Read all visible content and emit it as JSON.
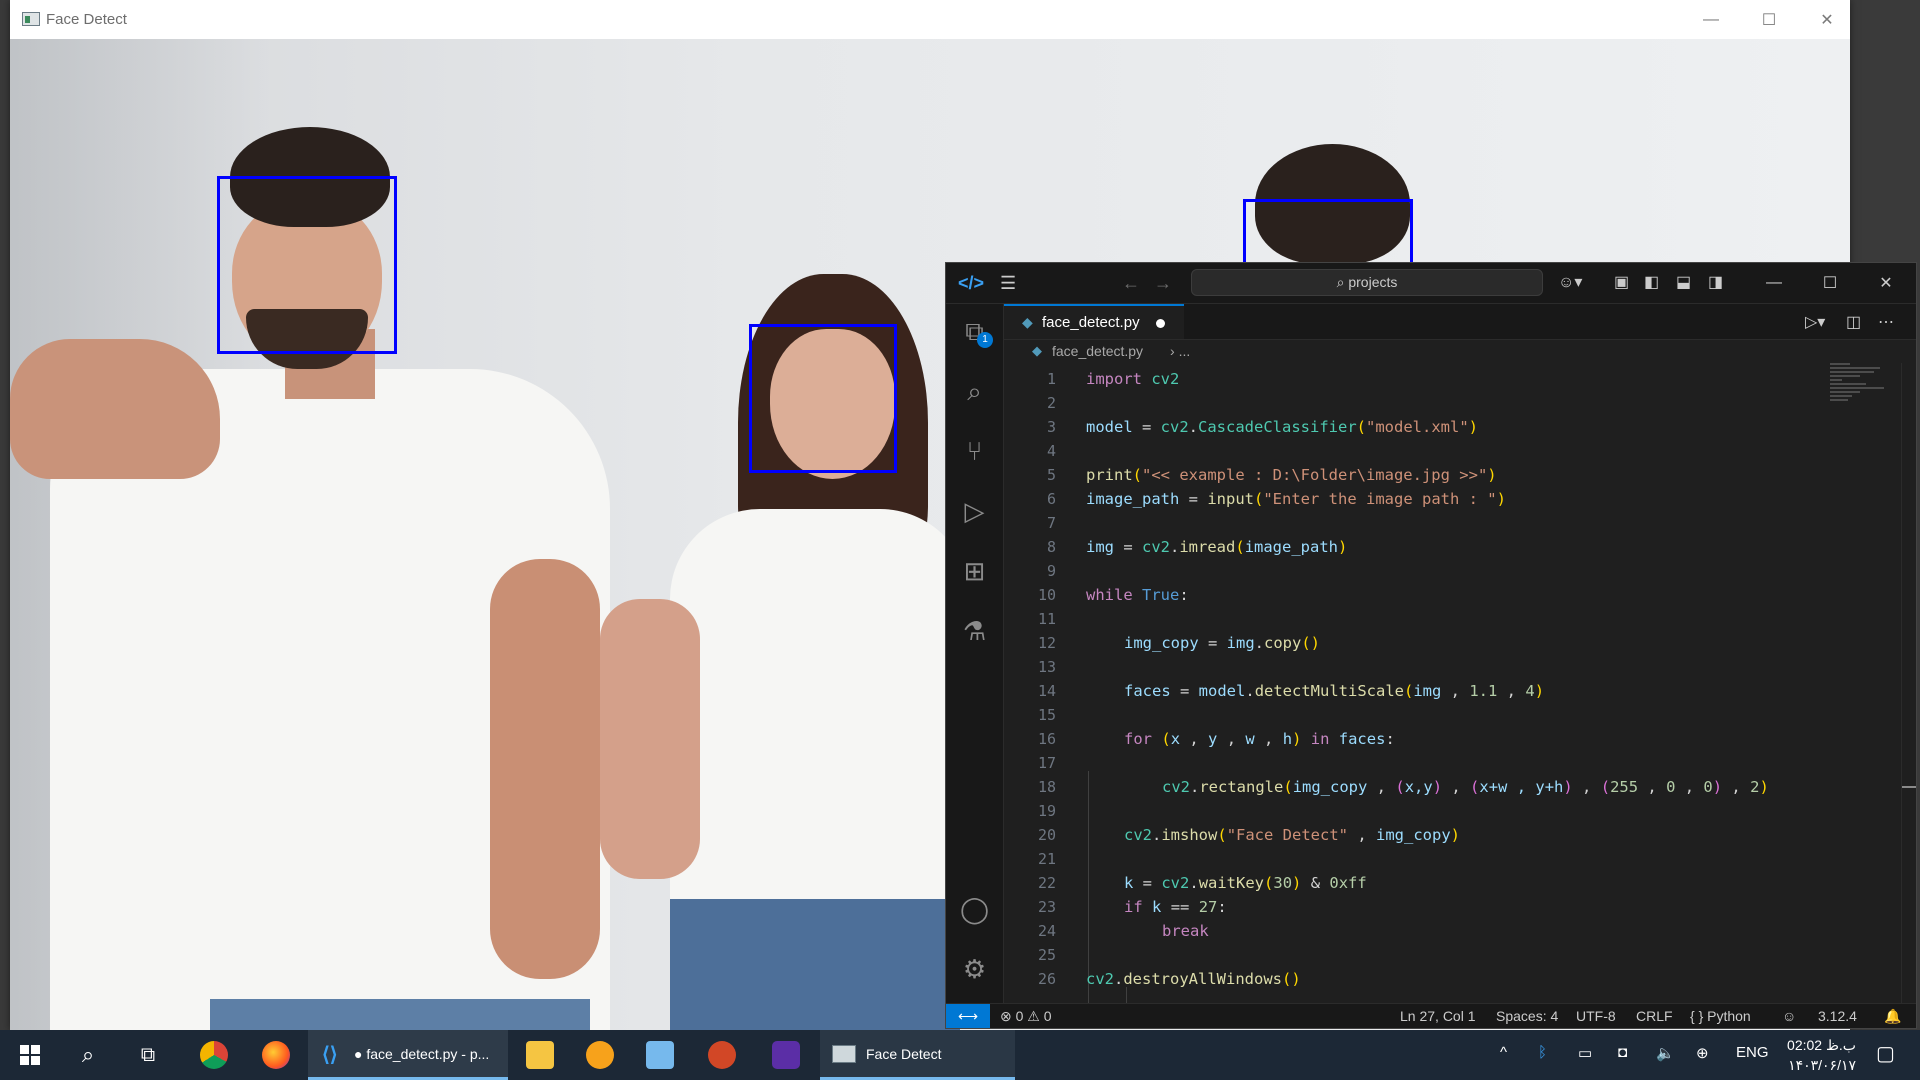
{
  "face_window": {
    "title": "Face Detect",
    "controls": [
      "—",
      "☐",
      "✕"
    ]
  },
  "vscode": {
    "search_label": "projects",
    "tab": {
      "filename": "face_detect.py"
    },
    "breadcrumb": {
      "file": "face_detect.py",
      "rest": "..."
    },
    "explorer_badge": "1",
    "line_numbers": [
      "1",
      "2",
      "3",
      "4",
      "5",
      "6",
      "7",
      "8",
      "9",
      "10",
      "11",
      "12",
      "13",
      "14",
      "15",
      "16",
      "17",
      "18",
      "19",
      "20",
      "21",
      "22",
      "23",
      "24",
      "25",
      "26"
    ],
    "code": {
      "l1_kw": "import",
      "l1_mod": "cv2",
      "l3_var": "model",
      "l3_mod": "cv2",
      "l3_cls": "CascadeClassifier",
      "l3_str": "\"model.xml\"",
      "l5_fn": "print",
      "l5_str": "\"<< example : D:\\Folder\\image.jpg >>\"",
      "l6_var": "image_path",
      "l6_fn": "input",
      "l6_str": "\"Enter the image path : \"",
      "l8_var": "img",
      "l8_mod": "cv2",
      "l8_fn": "imread",
      "l8_arg": "image_path",
      "l10_kw": "while",
      "l10_const": "True",
      "l12_var": "img_copy",
      "l12_obj": "img",
      "l12_fn": "copy",
      "l14_var": "faces",
      "l14_obj": "model",
      "l14_fn": "detectMultiScale",
      "l14_arg": "img",
      "l14_n1": "1.1",
      "l14_n2": "4",
      "l16_kw": "for",
      "l16_x": "x",
      "l16_y": "y",
      "l16_w": "w",
      "l16_h": "h",
      "l16_in": "in",
      "l16_faces": "faces",
      "l18_mod": "cv2",
      "l18_fn": "rectangle",
      "l18_a1": "img_copy",
      "l18_a2": "x,y",
      "l18_a3": "x+w , y+h",
      "l18_c1": "255",
      "l18_c2": "0",
      "l18_c3": "0",
      "l18_t": "2",
      "l20_mod": "cv2",
      "l20_fn": "imshow",
      "l20_str": "\"Face Detect\"",
      "l20_arg": "img_copy",
      "l22_var": "k",
      "l22_mod": "cv2",
      "l22_fn": "waitKey",
      "l22_n": "30",
      "l22_hex": "0xff",
      "l23_kw": "if",
      "l23_var": "k",
      "l23_n": "27",
      "l24_kw": "break",
      "l26_mod": "cv2",
      "l26_fn": "destroyAllWindows"
    },
    "status": {
      "errors": "0",
      "warnings": "0",
      "position": "Ln 27, Col 1",
      "spaces": "Spaces: 4",
      "encoding": "UTF-8",
      "eol": "CRLF",
      "language": "{ } Python",
      "interpreter": "3.12.4"
    }
  },
  "taskbar": {
    "vscode_label": "● face_detect.py - p...",
    "facedetect_label": "Face Detect",
    "language": "ENG",
    "time": "02:02 ب.ظ",
    "date": "۱۴۰۳/۰۶/۱۷"
  }
}
